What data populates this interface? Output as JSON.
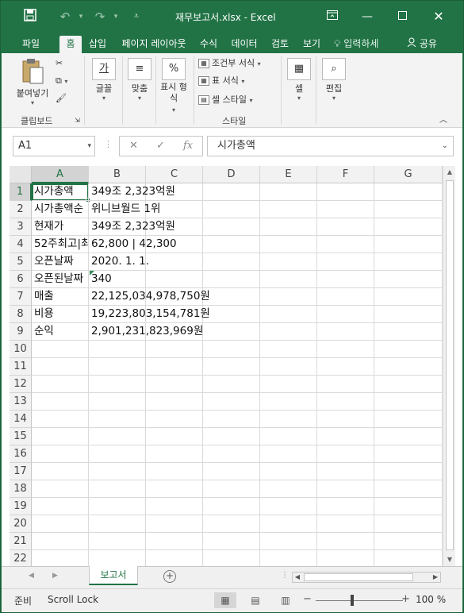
{
  "window": {
    "title": "재무보고서.xlsx - Excel",
    "icons": [
      "save-icon",
      "undo-icon",
      "redo-icon",
      "customize-qat-icon",
      "ribbon-display-icon",
      "minimize-icon",
      "maximize-icon",
      "close-icon"
    ]
  },
  "tabs": [
    {
      "label": "파일"
    },
    {
      "label": "홈"
    },
    {
      "label": "삽입"
    },
    {
      "label": "페이지 레이아웃"
    },
    {
      "label": "수식"
    },
    {
      "label": "데이터"
    },
    {
      "label": "검토"
    },
    {
      "label": "보기"
    }
  ],
  "tell_me": "입력하세",
  "share": "공유",
  "ribbon": {
    "clipboard": {
      "paste": "붙여넣기",
      "group": "클립보드"
    },
    "font": {
      "label": "글꼴",
      "icon_text": "가"
    },
    "align": {
      "label": "맞춤"
    },
    "number": {
      "label": "표시 형식",
      "icon_text": "%"
    },
    "styles": {
      "conditional": "조건부 서식",
      "table": "표 서식",
      "cell_style": "셀 스타일",
      "group": "스타일"
    },
    "cells": {
      "label": "셀"
    },
    "editing": {
      "label": "편집"
    }
  },
  "formula_bar": {
    "name_box": "A1",
    "fx": "fx",
    "content": "시가총액"
  },
  "columns": [
    "A",
    "B",
    "C",
    "D",
    "E",
    "F",
    "G"
  ],
  "rows": [
    "1",
    "2",
    "3",
    "4",
    "5",
    "6",
    "7",
    "8",
    "9",
    "10",
    "11",
    "12",
    "13",
    "14",
    "15",
    "16",
    "17",
    "18",
    "19",
    "20",
    "21",
    "22"
  ],
  "cells": {
    "A1": "시가총액",
    "B1": "349조 2,323억원",
    "A2": "시가총액순",
    "B2": "위니브월드 1위",
    "A3": "현재가",
    "B3": "349조 2,323억원",
    "A4": "52주최고|최",
    "B4": "62,800 | 42,300",
    "A5": "오픈날짜",
    "B5": "2020. 1. 1.",
    "A6": "오픈된날짜",
    "B6": "340",
    "A7": "매출",
    "B7": "22,125,034,978,750원",
    "A8": "비용",
    "B8": "19,223,803,154,781원",
    "A9": "순익",
    "B9": "2,901,231,823,969원"
  },
  "sheet_tab": "보고서",
  "status": {
    "ready": "준비",
    "scroll_lock": "Scroll Lock",
    "zoom": "100 %"
  },
  "colors": {
    "accent": "#217346"
  }
}
